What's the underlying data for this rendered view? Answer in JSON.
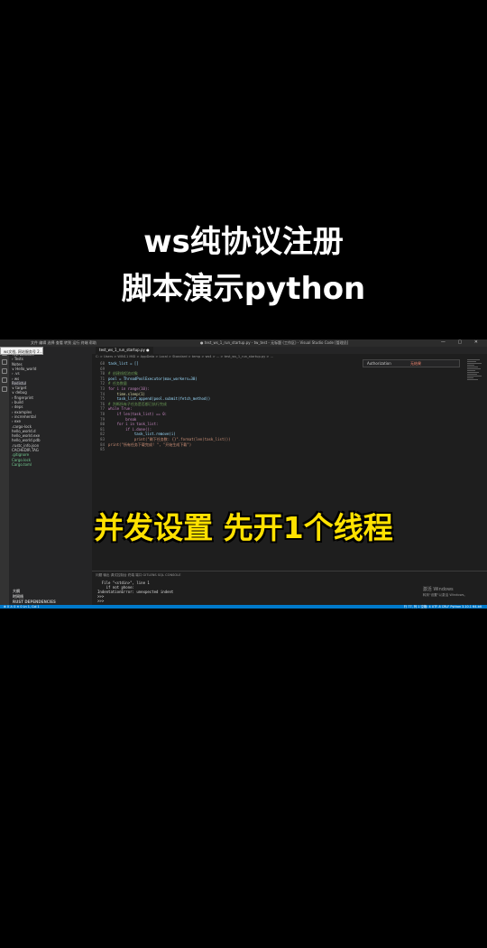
{
  "overlay": {
    "title_line1": "ws纯协议注册",
    "title_line2": "脚本演示python",
    "subtitle": "并发设置 先开1个线程"
  },
  "vscode": {
    "menu": "文件 编辑 选择 查看 转到 运行 终端 帮助",
    "window_title": "● test_ws_1_run_startup.py - tw_test - 无标题 (工作区) - Visual Studio Code [管理员]",
    "window_buttons": "— ▢ ✕",
    "popup": "ws文档, 网站服务号 2...",
    "tab_label": "test_ws_1_run_startup.py ●",
    "breadcrumb": "C: > Users > WIN11 MID > AppData > Local > Standard > temp > ws4 > ... > test_ws_1_run_startup.py > ...",
    "find_input": "Authorization",
    "find_result": "无结果",
    "sidebar": [
      {
        "label": "TWFEEshare",
        "style": "plain"
      },
      {
        "label": "› Tests",
        "style": "plain"
      },
      {
        "label": "  Notes",
        "style": "plain"
      },
      {
        "label": "∨ Hello_world",
        "style": "plain"
      },
      {
        "label": "  › .vs",
        "style": "plain"
      },
      {
        "label": "  › ws",
        "style": "plain"
      },
      {
        "label": "    Redistul",
        "style": "sel"
      },
      {
        "label": "∨ target",
        "style": "plain"
      },
      {
        "label": "  ∨ debug",
        "style": "plain"
      },
      {
        "label": "    › fingerprint",
        "style": "plain"
      },
      {
        "label": "    › build",
        "style": "plain"
      },
      {
        "label": "    › deps",
        "style": "plain"
      },
      {
        "label": "    › examples",
        "style": "plain"
      },
      {
        "label": "    › incremental",
        "style": "plain"
      },
      {
        "label": "    › exe",
        "style": "plain"
      },
      {
        "label": "    .cargo-lock",
        "style": "plain"
      },
      {
        "label": "    hello_world.d",
        "style": "plain"
      },
      {
        "label": "    hello_world.exe",
        "style": "plain"
      },
      {
        "label": "    hello_world.pdb",
        "style": "plain"
      },
      {
        "label": "  .rustc_info.json",
        "style": "plain"
      },
      {
        "label": "  CACHEDIR.TAG",
        "style": "plain"
      },
      {
        "label": ".gitignore",
        "style": "green"
      },
      {
        "label": "Cargo.lock",
        "style": "green"
      },
      {
        "label": "Cargo.toml",
        "style": "green"
      }
    ],
    "sidebar_bottom": [
      "大纲",
      "时间线",
      "RUST DEPENDENCIES"
    ],
    "code_lines": [
      {
        "n": "68",
        "text": "task_list = []",
        "cls": "c-var"
      },
      {
        "n": "69",
        "text": "",
        "cls": "c-pl"
      },
      {
        "n": "70",
        "text": "# 创建线程池对象",
        "cls": "c-com"
      },
      {
        "n": "71",
        "text": "pool = ThreadPoolExecutor(max_workers=30)",
        "cls": "c-var"
      },
      {
        "n": "72",
        "text": "# 任务数量",
        "cls": "c-com"
      },
      {
        "n": "73",
        "text": "for i in range(10):",
        "cls": "c-ctl"
      },
      {
        "n": "74",
        "text": "    time.sleep(1)",
        "cls": "c-fn"
      },
      {
        "n": "75",
        "text": "    task_list.append(pool.submit(fetch_method))",
        "cls": "c-var"
      },
      {
        "n": "76",
        "text": "# 判断所有子任务是否都已执行完成",
        "cls": "c-com"
      },
      {
        "n": "77",
        "text": "while True:",
        "cls": "c-ctl"
      },
      {
        "n": "78",
        "text": "    if len(task_list) == 0:",
        "cls": "c-ctl"
      },
      {
        "n": "79",
        "text": "        break",
        "cls": "c-ctl"
      },
      {
        "n": "80",
        "text": "    for i in task_list:",
        "cls": "c-ctl"
      },
      {
        "n": "81",
        "text": "        if i.done():",
        "cls": "c-ctl"
      },
      {
        "n": "82",
        "text": "            task_list.remove(i)",
        "cls": "c-var"
      },
      {
        "n": "83",
        "text": "            print(\"剩下任务数: {}\".format(len(task_list)))",
        "cls": "c-str"
      },
      {
        "n": "84",
        "text": "print(\"所有任务下载完成! \", \"开始生成下载\")",
        "cls": "c-str"
      },
      {
        "n": "85",
        "text": "",
        "cls": "c-pl"
      }
    ],
    "panel_tabs": "问题  输出  调试控制台  终端  端口  GITLENS  SQL CONSOLE",
    "terminal_lines": [
      "  File \"<stdin>\", line 1",
      "    if not phone:",
      "IndentationError: unexpected indent",
      ">>>",
      ">>>"
    ],
    "watermark_line1": "激活 Windows",
    "watermark_line2": "转到\"设置\"以激活 Windows。",
    "status_left": "⊗ 0 ⚠ 0   ✕ 0   Ln 1, Col 1",
    "status_right": "行 77, 列 1   空格: 4   UTF-8   CRLF   Python   3.10.1 64-bit"
  }
}
